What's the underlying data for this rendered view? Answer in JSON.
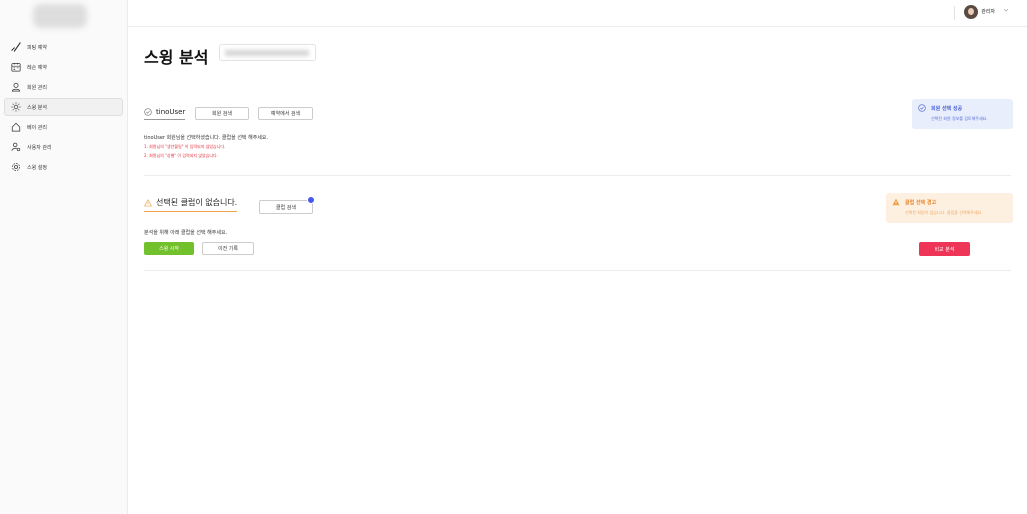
{
  "header": {
    "user_name": "관리자"
  },
  "sidebar": {
    "items": [
      {
        "label": "피팅 예약",
        "icon": "checkmark-icon"
      },
      {
        "label": "레슨 예약",
        "icon": "calendar-icon"
      },
      {
        "label": "회원 관리",
        "icon": "user-icon"
      },
      {
        "label": "스윙 분석",
        "icon": "sun-icon",
        "active": true
      },
      {
        "label": "베이 관리",
        "icon": "home-icon"
      },
      {
        "label": "사용자 관리",
        "icon": "user-settings-icon"
      },
      {
        "label": "스윙 설정",
        "icon": "gear-icon"
      }
    ]
  },
  "main": {
    "title": "스윙 분석",
    "member_section": {
      "selected_user": "tinoUser",
      "search_member_label": "회원 검색",
      "search_reservation_label": "예약에서 검색",
      "description": "tinoUser 회원님을 선택하셨습니다. 클럽을 선택 해주세요.",
      "warnings": [
        "1. 회원님의 \"생년월일\" 이 입력되지 않았습니다.",
        "2. 회원님의 \"성별\" 이 입력되지 않았습니다."
      ]
    },
    "club_section": {
      "status_text": "선택된 클럽이 없습니다.",
      "search_club_label": "클럽 검색",
      "description": "분석을 위해 아래 클럽을 선택 해주세요.",
      "start_label": "스윙 시작",
      "history_label": "이전 기록",
      "compare_label": "비교 분석"
    }
  },
  "toasts": {
    "info": {
      "title": "회원 선택 성공",
      "message": "선택된 회원 정보를 검토해주세요."
    },
    "warning": {
      "title": "클럽 선택 경고",
      "message": "선택된 회원이 없습니다. 클럽을 선택해주세요."
    }
  },
  "colors": {
    "accent_green": "#72c02c",
    "accent_red": "#ee3558",
    "info_blue": "#4a62d8",
    "warning_orange": "#e8862a",
    "notification_dot": "#4758f2"
  }
}
